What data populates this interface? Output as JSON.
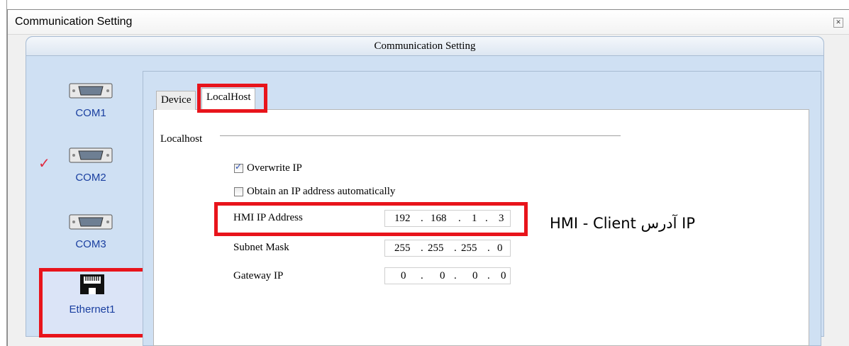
{
  "window": {
    "title": "Communication Setting",
    "close_icon": "close-icon"
  },
  "panel": {
    "header": "Communication Setting"
  },
  "ports": [
    {
      "label": "COM1",
      "icon": "serial-port-icon"
    },
    {
      "label": "COM2",
      "icon": "serial-port-icon",
      "checked": true
    },
    {
      "label": "COM3",
      "icon": "serial-port-icon"
    },
    {
      "label": "Ethernet1",
      "icon": "ethernet-port-icon",
      "selected": true
    }
  ],
  "tabs": [
    {
      "label": "Device",
      "active": false
    },
    {
      "label": "LocalHost",
      "active": true
    }
  ],
  "localhost": {
    "group_label": "Localhost",
    "overwrite_ip": {
      "label": "Overwrite IP",
      "checked": true
    },
    "obtain_auto": {
      "label": "Obtain an IP address automatically",
      "checked": false
    },
    "hmi_ip": {
      "label": "HMI IP Address",
      "octets": [
        "192",
        "168",
        "1",
        "3"
      ]
    },
    "subnet": {
      "label": "Subnet Mask",
      "octets": [
        "255",
        "255",
        "255",
        "0"
      ]
    },
    "gateway": {
      "label": "Gateway IP",
      "octets": [
        "0",
        "0",
        "0",
        "0"
      ]
    }
  },
  "annotation": {
    "text": "HMI - Client آدرس IP"
  },
  "colors": {
    "highlight": "#e8141b",
    "panel": "#cfe0f3",
    "port_label": "#1a3fa0",
    "check_red": "#e02b40"
  }
}
